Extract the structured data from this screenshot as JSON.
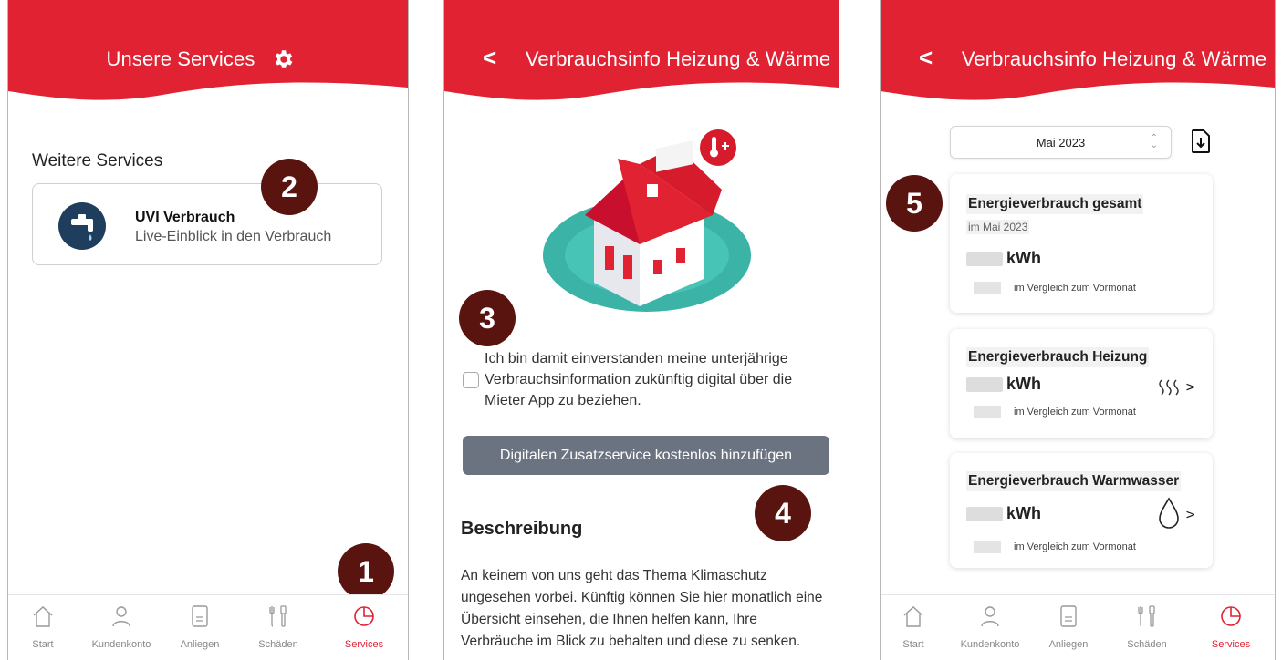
{
  "screens": [
    {
      "header": {
        "title": "Unsere Services"
      },
      "section_title": "Weitere Services",
      "service": {
        "name": "UVI Verbrauch",
        "description": "Live-Einblick in den Verbrauch"
      },
      "badges": [
        "1",
        "2"
      ]
    },
    {
      "header": {
        "title": "Verbrauchsinfo Heizung & Wärme",
        "back": "<"
      },
      "consent_text": "Ich bin damit einverstanden meine unterjährige Verbrauchsinformation zukünftig digital über die Mieter App zu beziehen.",
      "button_label": "Digitalen Zusatzservice kostenlos hinzufügen",
      "description_heading": "Beschreibung",
      "description_text": "An keinem von uns geht das Thema Klimaschutz ungesehen vorbei. Künftig können Sie hier monatlich eine Übersicht einsehen, die Ihnen helfen kann, Ihre Verbräuche im Blick zu behalten und diese zu senken.",
      "badges": [
        "3",
        "4"
      ]
    },
    {
      "header": {
        "title": "Verbrauchsinfo Heizung & Wärme",
        "back": "<"
      },
      "month": "Mai 2023",
      "cards": [
        {
          "title": "Energieverbrauch gesamt",
          "subtitle": "im Mai 2023",
          "unit": "kWh",
          "comparison": "im Vergleich zum Vormonat"
        },
        {
          "title": "Energieverbrauch Heizung",
          "unit": "kWh",
          "comparison": "im Vergleich zum Vormonat",
          "icon": "heat-waves-icon",
          "chevron": ">"
        },
        {
          "title": "Energieverbrauch Warmwasser",
          "unit": "kWh",
          "comparison": "im Vergleich zum Vormonat",
          "icon": "water-drop-icon",
          "chevron": ">"
        }
      ],
      "badges": [
        "5"
      ]
    }
  ],
  "tabbar": {
    "items": [
      {
        "label": "Start",
        "icon": "home-icon"
      },
      {
        "label": "Kundenkonto",
        "icon": "user-icon"
      },
      {
        "label": "Anliegen",
        "icon": "document-icon"
      },
      {
        "label": "Schäden",
        "icon": "tools-icon"
      },
      {
        "label": "Services",
        "icon": "services-pie-icon",
        "active": true
      }
    ]
  },
  "colors": {
    "brand_red": "#e02232",
    "badge": "#5a1410",
    "button_grey": "#6b7280",
    "icon_navy": "#1f3d5c"
  }
}
